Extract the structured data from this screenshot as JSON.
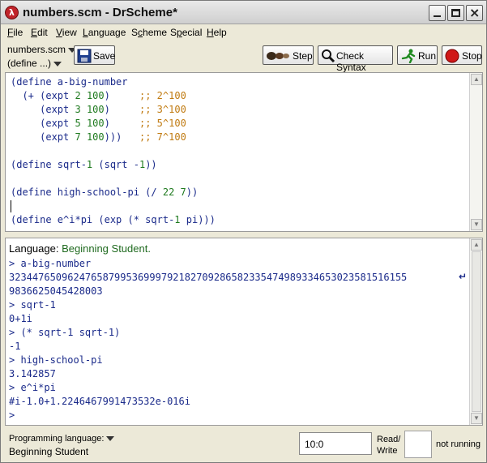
{
  "window": {
    "title": "numbers.scm - DrScheme*",
    "icon_letter": "λ"
  },
  "menu": [
    "File",
    "Edit",
    "View",
    "Language",
    "Scheme",
    "Special",
    "Help"
  ],
  "menu_underline_index": [
    0,
    0,
    0,
    0,
    1,
    1,
    0
  ],
  "toolbar": {
    "file_name": "numbers.scm",
    "define_label": "(define ...)",
    "save_label": "Save",
    "step_label": "Step",
    "check_syntax_label": "Check Syntax",
    "run_label": "Run",
    "stop_label": "Stop"
  },
  "definitions": {
    "code_lines": [
      "(define a-big-number",
      "  (+ (expt 2 100)     ;; 2^100",
      "     (expt 3 100)     ;; 3^100",
      "     (expt 5 100)     ;; 5^100",
      "     (expt 7 100)))   ;; 7^100",
      "",
      "(define sqrt-1 (sqrt -1))",
      "",
      "(define high-school-pi (/ 22 7))",
      "",
      "(define e^i*pi (exp (* sqrt-1 pi)))"
    ]
  },
  "interactions": {
    "language_prefix": "Language:",
    "language_name": "Beginning Student.",
    "lines": [
      "> a-big-number",
      "32344765096247658799536999792182709286582335474989334653023581516155",
      "9836625045428003",
      "> sqrt-1",
      "0+1i",
      "> (* sqrt-1 sqrt-1)",
      "-1",
      "> high-school-pi",
      "3.142857",
      "> e^i*pi",
      "#i-1.0+1.2246467991473532e-016i",
      ">"
    ]
  },
  "status": {
    "programming_language_label": "Programming language:",
    "programming_language_value": "Beginning Student",
    "cursor_position": "10:0",
    "read_write_label": "Read/\nWrite",
    "run_state": "not running"
  },
  "colors": {
    "code_text": "#1a2a8a",
    "comment": "#c07a10",
    "number": "#1f7a1f",
    "language_name": "#1f6a1f",
    "stop_red": "#d01818",
    "run_green": "#1f8a1f"
  }
}
